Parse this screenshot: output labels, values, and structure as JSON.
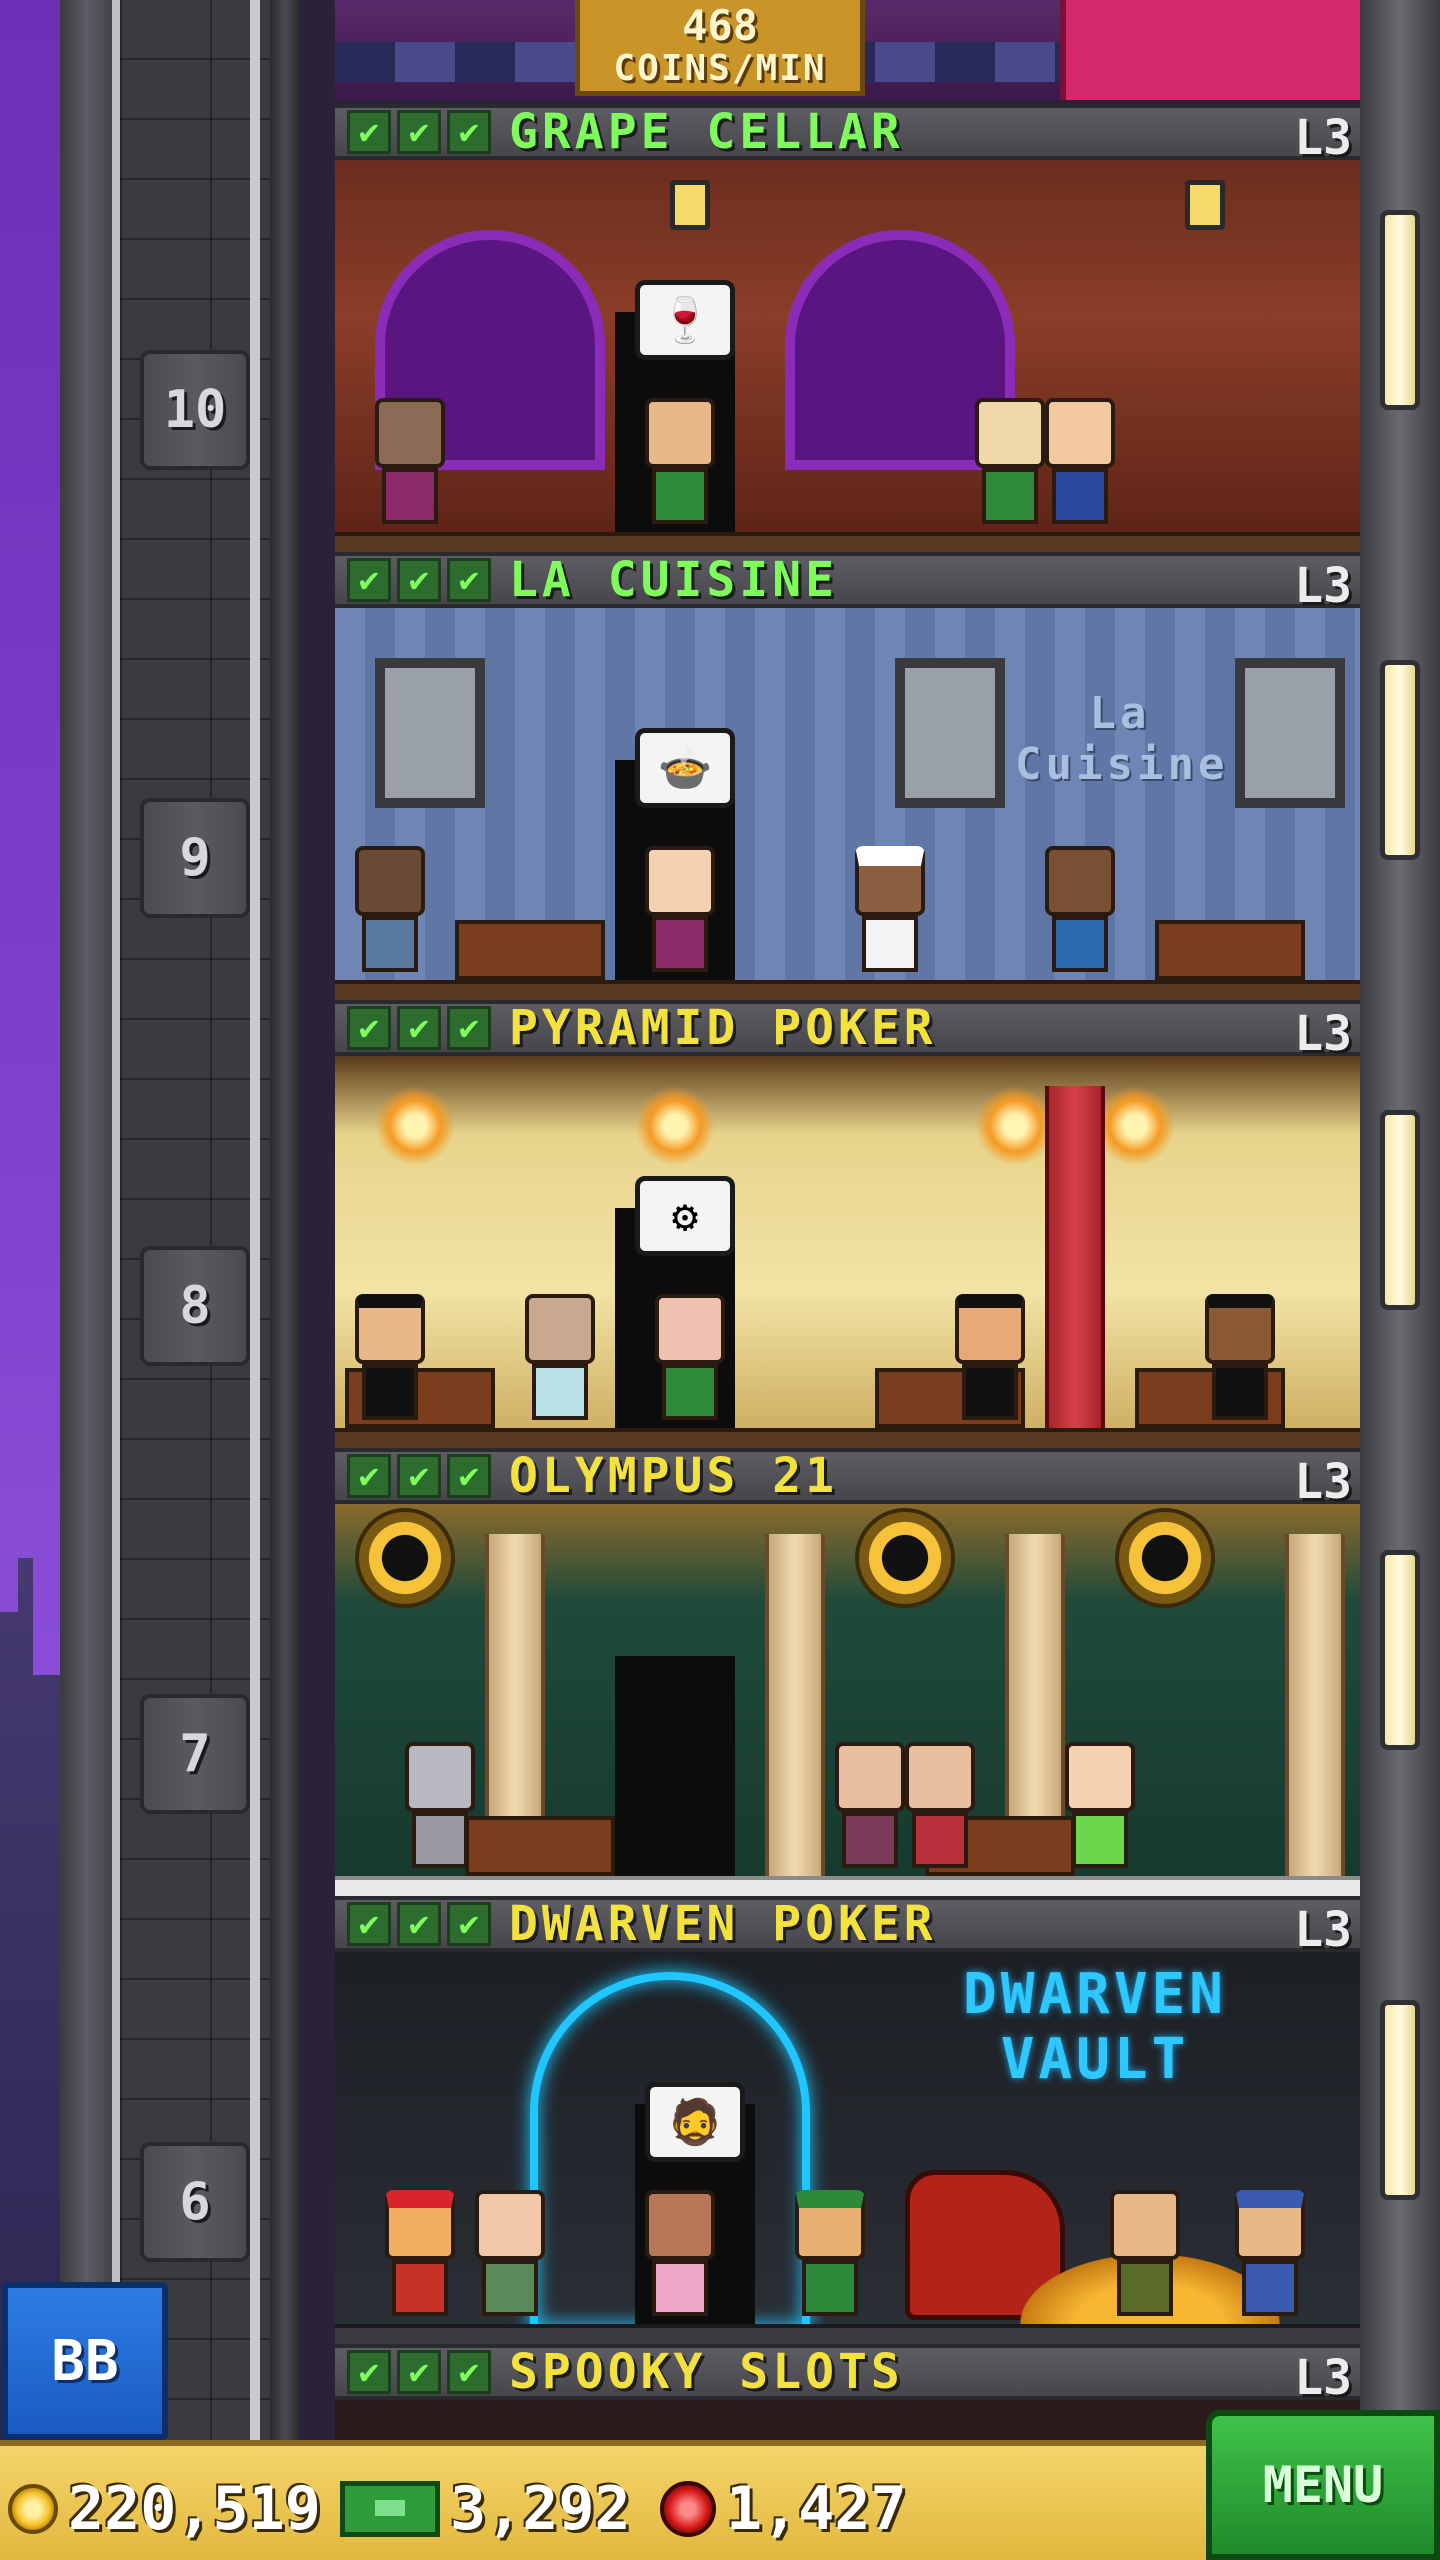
{
  "top_floor": {
    "coins_per_min_value": "468",
    "coins_per_min_unit": "COINS/MIN"
  },
  "floor_numbers": [
    "10",
    "9",
    "8",
    "7",
    "6"
  ],
  "floors": [
    {
      "name": "GRAPE CELLAR",
      "level": "L3",
      "name_color": "#7dfc5a",
      "theme": "grape",
      "bubble": "🍷"
    },
    {
      "name": "LA CUISINE",
      "level": "L3",
      "name_color": "#7dfc5a",
      "theme": "cuisine",
      "bubble": "🍲",
      "sign": "La Cuisine"
    },
    {
      "name": "PYRAMID POKER",
      "level": "L3",
      "name_color": "#f4e23c",
      "theme": "pyramid",
      "bubble": "⚙"
    },
    {
      "name": "OLYMPUS 21",
      "level": "L3",
      "name_color": "#f4e23c",
      "theme": "olympus"
    },
    {
      "name": "DWARVEN POKER",
      "level": "L3",
      "name_color": "#f4e23c",
      "theme": "dwarven",
      "bubble": "🧔",
      "sign": "DWARVEN VAULT"
    },
    {
      "name": "SPOOKY SLOTS",
      "level": "L3",
      "name_color": "#f4e23c",
      "theme": "spooky"
    }
  ],
  "checkmark": "✔",
  "bb_button": "BB",
  "hud": {
    "coins": "220,519",
    "bux": "3,292",
    "gems": "1,427",
    "menu": "MENU"
  },
  "icons": [
    "coin-icon",
    "bux-icon",
    "gem-icon",
    "check-icon",
    "lamp-icon"
  ]
}
